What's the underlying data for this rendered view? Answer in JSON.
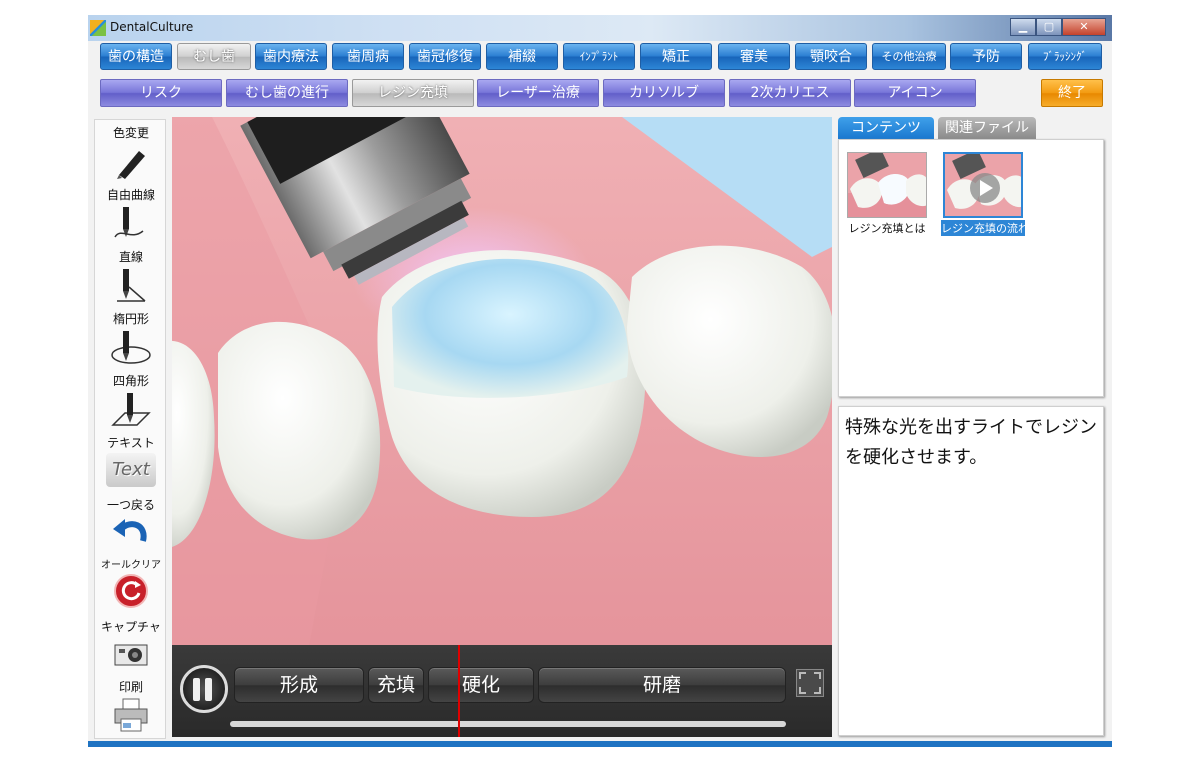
{
  "window": {
    "title": "DentalCulture"
  },
  "nav_primary": [
    {
      "label": "歯の構造"
    },
    {
      "label": "むし歯",
      "active": true
    },
    {
      "label": "歯内療法"
    },
    {
      "label": "歯周病"
    },
    {
      "label": "歯冠修復"
    },
    {
      "label": "補綴"
    },
    {
      "label": "ｲﾝﾌﾟﾗﾝﾄ"
    },
    {
      "label": "矯正"
    },
    {
      "label": "審美"
    },
    {
      "label": "顎咬合"
    },
    {
      "label": "その他治療"
    },
    {
      "label": "予防"
    },
    {
      "label": "ﾌﾞﾗｯｼﾝｸﾞ"
    }
  ],
  "nav_secondary": [
    {
      "label": "リスク"
    },
    {
      "label": "むし歯の進行"
    },
    {
      "label": "レジン充填",
      "active": true
    },
    {
      "label": "レーザー治療"
    },
    {
      "label": "カリソルブ"
    },
    {
      "label": "2次カリエス"
    },
    {
      "label": "アイコン"
    }
  ],
  "exit_label": "終了",
  "toolbar": {
    "color": "色変更",
    "freehand": "自由曲線",
    "line": "直線",
    "ellipse": "楕円形",
    "rect": "四角形",
    "text": "テキスト",
    "text_icon": "Text",
    "undo": "一つ戻る",
    "clear": "オールクリア",
    "capture": "キャプチャ",
    "print": "印刷"
  },
  "player": {
    "chapters": [
      "形成",
      "充填",
      "硬化",
      "研磨"
    ],
    "progress": 0.41
  },
  "tabs": {
    "contents": "コンテンツ",
    "files": "関連ファイル"
  },
  "thumbnails": [
    {
      "label": "レジン充填とは"
    },
    {
      "label": "レジン充填の流れ",
      "selected": true
    }
  ],
  "description": "特殊な光を出すライトでレジンを硬化させます。",
  "colors": {
    "accent": "#2d86d6",
    "active_gray": "#c8c8c8",
    "exit": "#f39b12",
    "playhead": "#e00000"
  }
}
